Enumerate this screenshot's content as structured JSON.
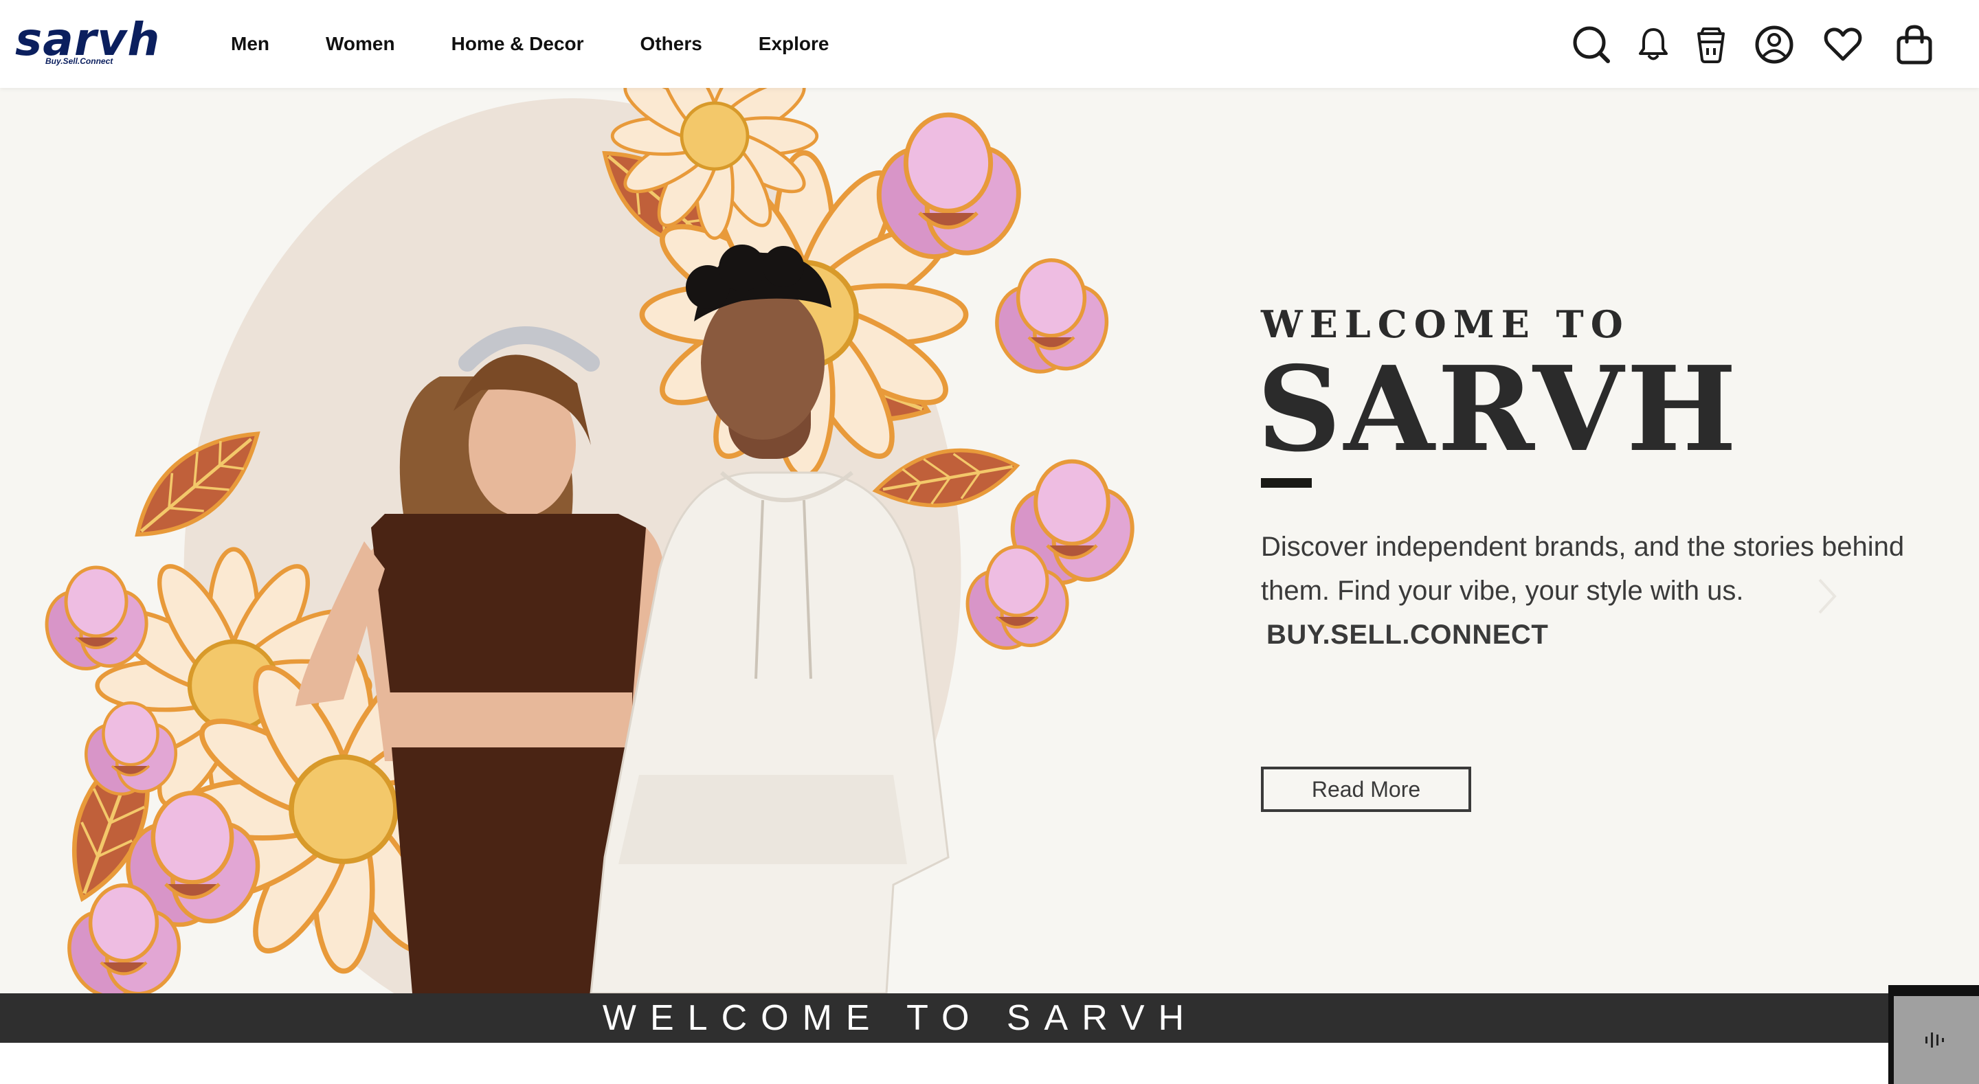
{
  "brand": {
    "name": "sarvh",
    "tagline": "Buy.Sell.Connect"
  },
  "nav": {
    "items": [
      {
        "label": "Men"
      },
      {
        "label": "Women"
      },
      {
        "label": "Home & Decor"
      },
      {
        "label": "Others"
      },
      {
        "label": "Explore"
      }
    ]
  },
  "header_icons": [
    "search-icon",
    "bell-icon",
    "cup-icon",
    "user-icon",
    "heart-icon",
    "bag-icon"
  ],
  "hero": {
    "welcome_to": "WELCOME TO",
    "title": "SARVH",
    "description": "Discover independent brands, and the stories behind them. Find your vibe, your style with us.",
    "tagline": "BUY.SELL.CONNECT",
    "cta_label": "Read More"
  },
  "bottom_banner": {
    "text": "WELCOME TO SARVH"
  },
  "widget": {
    "icon": "audio-wave-icon"
  },
  "colors": {
    "brand": "#0b1f5e",
    "hero_bg": "#f7f6f2",
    "text_dark": "#2b2b2b",
    "banner_bg": "#2f2f2f",
    "circle": "#ece2d8",
    "flower_pink": "#d895c8",
    "flower_orange": "#e89a3a",
    "top_brown": "#4a2414",
    "hoodie": "#f3f0ea"
  }
}
